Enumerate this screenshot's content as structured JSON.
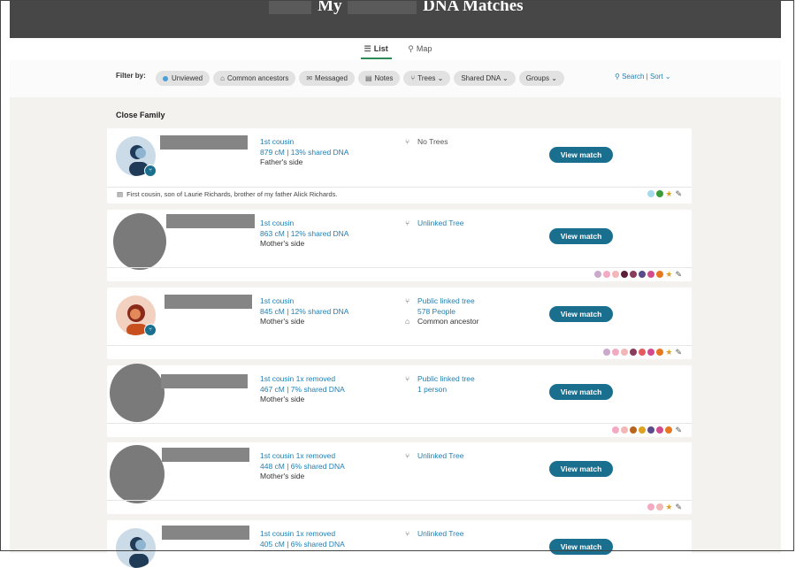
{
  "header": {
    "title_prefix": "My",
    "title_main": "DNA Matches"
  },
  "tabs": [
    {
      "label": "List",
      "icon": "list-icon",
      "active": true
    },
    {
      "label": "Map",
      "icon": "map-pin-icon",
      "active": false
    }
  ],
  "filters": {
    "label": "Filter by:",
    "chips": [
      {
        "label": "Unviewed",
        "icon": "dot-icon"
      },
      {
        "label": "Common ancestors",
        "icon": "ancestor-icon"
      },
      {
        "label": "Messaged",
        "icon": "envelope-icon"
      },
      {
        "label": "Notes",
        "icon": "note-icon"
      },
      {
        "label": "Trees",
        "icon": "tree-icon"
      },
      {
        "label": "Shared DNA",
        "icon": ""
      },
      {
        "label": "Groups",
        "icon": ""
      }
    ],
    "search_sort": "Search | Sort"
  },
  "section": {
    "title": "Close Family"
  },
  "matches": [
    {
      "relationship": "1st cousin",
      "shared": "879 cM | 13% shared DNA",
      "side": "Father's side",
      "tree_lines": [
        "No Trees"
      ],
      "tree_icon": "no-tree-icon",
      "button": "View match",
      "note": "First cousin, son of Laurie Richards, brother of my father Alick Richards.",
      "groups": [
        "#a6d8ee",
        "#3a9d3a"
      ],
      "starred": true
    },
    {
      "relationship": "1st cousin",
      "shared": "863 cM | 12% shared DNA",
      "side": "Mother's side",
      "tree_lines": [
        "Unlinked Tree"
      ],
      "tree_icon": "tree-icon",
      "button": "View match",
      "note": "",
      "groups": [
        "#c9a9cc",
        "#f4a9c3",
        "#f4b7b7",
        "#5b1f3a",
        "#8b3b5b",
        "#5a4a8a",
        "#d14b8f",
        "#e87722"
      ],
      "starred": true
    },
    {
      "relationship": "1st cousin",
      "shared": "845 cM | 12% shared DNA",
      "side": "Mother's side",
      "tree_lines": [
        "Public linked tree",
        "578 People",
        "Common ancestor"
      ],
      "tree_icon": "tree-icon",
      "button": "View match",
      "note": "",
      "groups": [
        "#c9a9cc",
        "#f4a9c3",
        "#f4b7b7",
        "#8b3b5b",
        "#e65b5b",
        "#d14b8f",
        "#e87722"
      ],
      "starred": true
    },
    {
      "relationship": "1st cousin 1x removed",
      "shared": "467 cM | 7% shared DNA",
      "side": "Mother's side",
      "tree_lines": [
        "Public linked tree",
        "1 person"
      ],
      "tree_icon": "tree-icon",
      "button": "View match",
      "note": "",
      "groups": [
        "#f4a9c3",
        "#f4b7b7",
        "#b8651e",
        "#e0a020",
        "#5a4a8a",
        "#d14b8f",
        "#e87722"
      ],
      "starred": false
    },
    {
      "relationship": "1st cousin 1x removed",
      "shared": "448 cM | 6% shared DNA",
      "side": "Mother's side",
      "tree_lines": [
        "Unlinked Tree"
      ],
      "tree_icon": "tree-icon",
      "button": "View match",
      "note": "",
      "groups": [
        "#f4a9c3",
        "#f4b7b7"
      ],
      "starred": true
    },
    {
      "relationship": "1st cousin 1x removed",
      "shared": "405 cM | 6% shared DNA",
      "side": "",
      "tree_lines": [
        "Unlinked Tree"
      ],
      "tree_icon": "tree-icon",
      "button": "View match",
      "note": "",
      "groups": [],
      "starred": false
    }
  ]
}
